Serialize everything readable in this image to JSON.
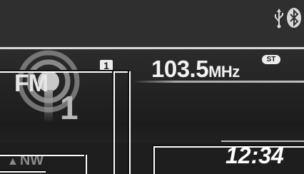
{
  "status_bar": {
    "usb_icon": "usb-icon",
    "bluetooth_icon": "bluetooth-icon"
  },
  "audio": {
    "source_label": "FM",
    "preset_large": "1",
    "preset_badge": "1",
    "frequency_value": "103.5",
    "frequency_unit": "MHz",
    "stereo_badge": "ST"
  },
  "navigation": {
    "compass_heading": "NW"
  },
  "clock": {
    "time": "12:34"
  },
  "colors": {
    "background": "#2f2f2f",
    "text_primary": "#f2f2f2",
    "badge_bg": "#ececec",
    "compass_text": "#8a8a8a"
  }
}
